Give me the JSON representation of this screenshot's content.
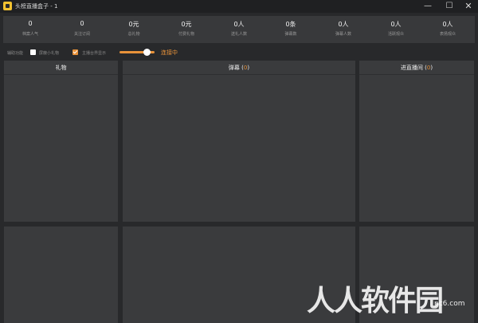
{
  "window": {
    "title": "头榜直播盒子 - 1",
    "minimize": "—",
    "maximize": "☐",
    "close": "✕"
  },
  "stats": [
    {
      "value": "0",
      "label": "档案人气"
    },
    {
      "value": "0",
      "label": "关注订阅"
    },
    {
      "value": "0元",
      "label": "总礼物"
    },
    {
      "value": "0元",
      "label": "付费礼物"
    },
    {
      "value": "0人",
      "label": "送礼人数"
    },
    {
      "value": "0条",
      "label": "弹幕数"
    },
    {
      "value": "0人",
      "label": "弹幕人数"
    },
    {
      "value": "0人",
      "label": "活跃观众"
    },
    {
      "value": "0人",
      "label": "表扬观众"
    }
  ],
  "options": {
    "feature_label": "辅助功能",
    "hide_small_gift": "屏蔽小礼物",
    "hide_small_gift_checked": false,
    "show_dialog": "主播台界显示",
    "show_dialog_checked": true,
    "connection_status": "连接中",
    "colors": {
      "accent": "#e8923a"
    }
  },
  "panels": {
    "gift_title": "礼物",
    "danmu_title": "弹幕",
    "danmu_count": "0",
    "enter_title": "进直播间",
    "enter_count": "0"
  },
  "watermark": {
    "main": "人人软件园",
    "sub": "pc6.com"
  }
}
